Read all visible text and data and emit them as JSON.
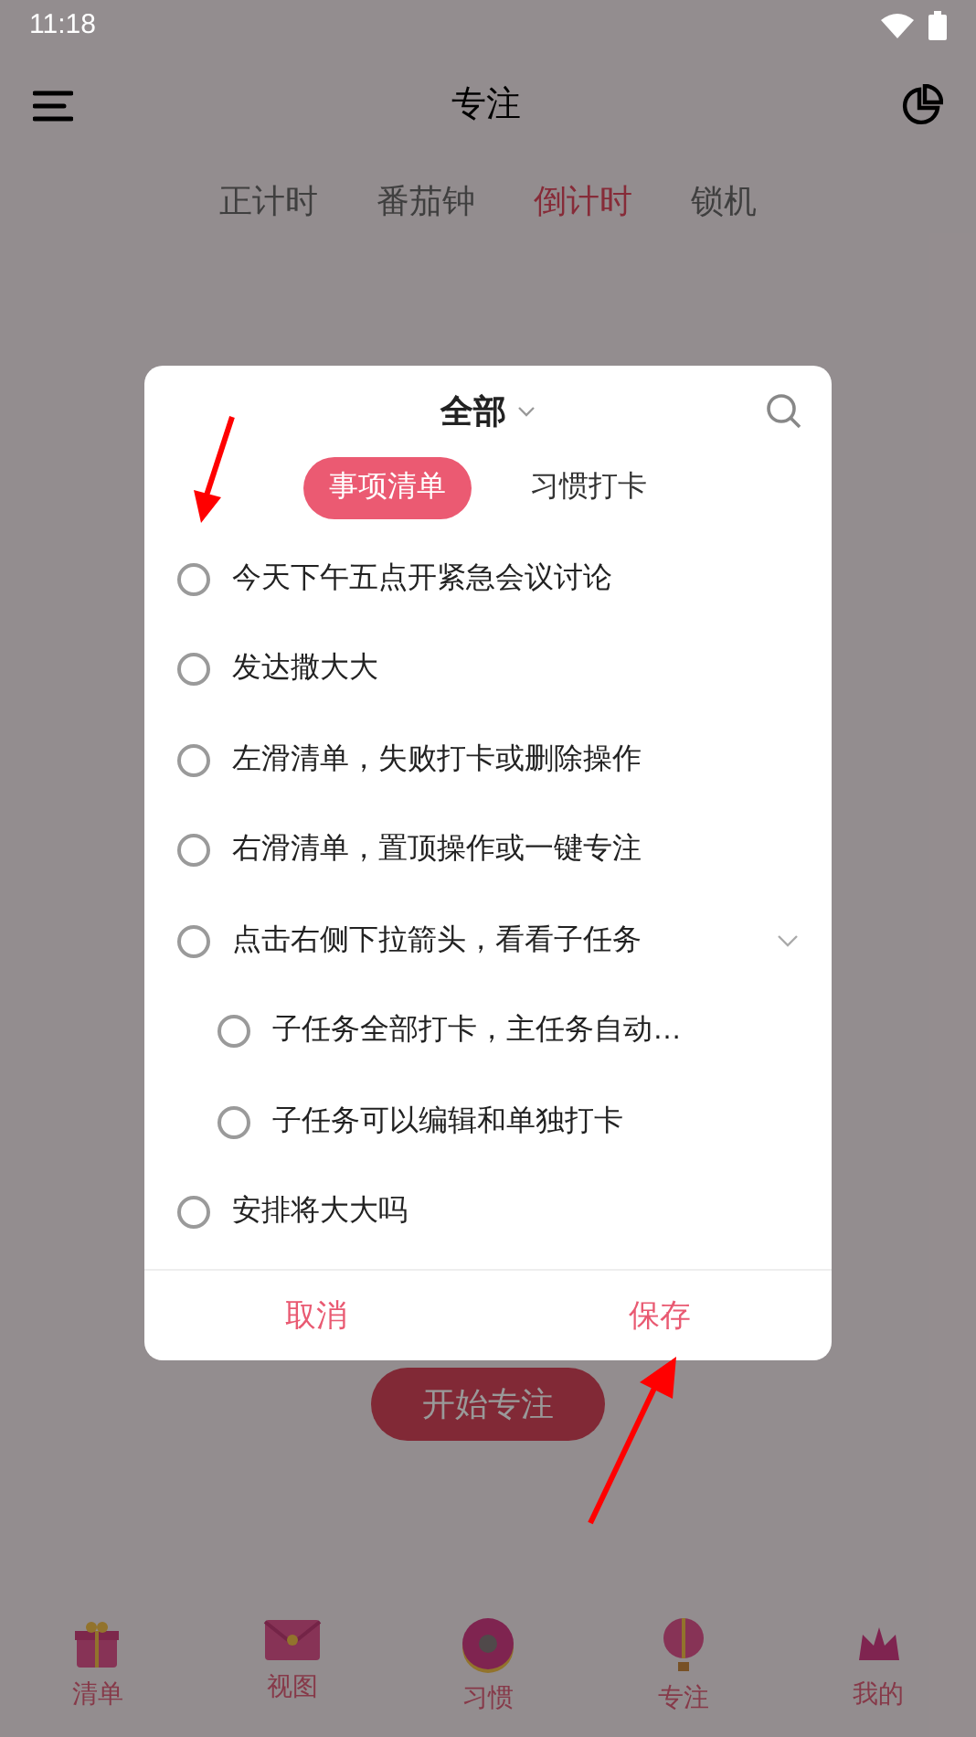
{
  "status_bar": {
    "time": "11:18"
  },
  "header": {
    "title": "专注"
  },
  "mode_tabs": [
    {
      "label": "正计时",
      "selected": false
    },
    {
      "label": "番茄钟",
      "selected": false
    },
    {
      "label": "倒计时",
      "selected": true
    },
    {
      "label": "锁机",
      "selected": false
    }
  ],
  "start_button": "开始专注",
  "bottom_nav": [
    {
      "label": "清单",
      "kind": "gift"
    },
    {
      "label": "视图",
      "kind": "envelope"
    },
    {
      "label": "习惯",
      "kind": "donut"
    },
    {
      "label": "专注",
      "kind": "balloon"
    },
    {
      "label": "我的",
      "kind": "crown"
    }
  ],
  "dialog": {
    "filter": "全部",
    "tabs": [
      {
        "label": "事项清单",
        "selected": true
      },
      {
        "label": "习惯打卡",
        "selected": false
      }
    ],
    "tasks": [
      {
        "label": "今天下午五点开紧急会议讨论",
        "checked": false
      },
      {
        "label": "发达撒大大",
        "checked": false
      },
      {
        "label": "左滑清单，失败打卡或删除操作",
        "checked": false
      },
      {
        "label": "右滑清单，置顶操作或一键专注",
        "checked": false
      },
      {
        "label": "点击右侧下拉箭头，看看子任务",
        "checked": false,
        "children": [
          {
            "label": "子任务全部打卡，主任务自动…",
            "checked": false
          },
          {
            "label": "子任务可以编辑和单独打卡",
            "checked": false
          }
        ]
      },
      {
        "label": "安排将大大吗",
        "checked": false
      }
    ],
    "cancel": "取消",
    "save": "保存"
  }
}
